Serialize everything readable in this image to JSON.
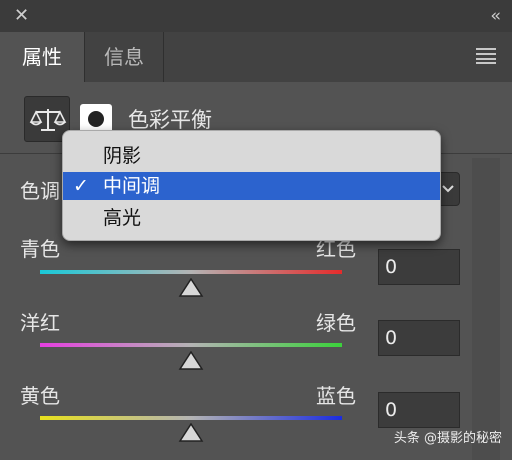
{
  "window": {
    "close_glyph": "✕",
    "collapse_glyph": "‹‹"
  },
  "tabs": [
    {
      "label": "属性",
      "active": true
    },
    {
      "label": "信息",
      "active": false
    }
  ],
  "header": {
    "title": "色彩平衡",
    "icon": "balance-scale-icon",
    "mask_icon": "layer-mask-icon"
  },
  "tone": {
    "label": "色调",
    "selected": "中间调"
  },
  "dropdown": {
    "items": [
      {
        "label": "阴影",
        "selected": false
      },
      {
        "label": "中间调",
        "selected": true
      },
      {
        "label": "高光",
        "selected": false
      }
    ],
    "check_glyph": "✓"
  },
  "sliders": [
    {
      "left_label": "青色",
      "right_label": "红色",
      "value": "0",
      "position": 0.5,
      "colors": [
        "#19c9d8",
        "#b4b4b4",
        "#e52b2b"
      ]
    },
    {
      "left_label": "洋红",
      "right_label": "绿色",
      "value": "0",
      "position": 0.5,
      "colors": [
        "#e63fe0",
        "#b4b4b4",
        "#3bd13b"
      ]
    },
    {
      "left_label": "黄色",
      "right_label": "蓝色",
      "value": "0",
      "position": 0.5,
      "colors": [
        "#e8e11d",
        "#b4b4b4",
        "#1b2ce0"
      ]
    }
  ],
  "watermark": "头条 @摄影的秘密",
  "colors": {
    "panel_bg": "#535353",
    "selection_blue": "#2c63ce",
    "dropdown_bg": "#d9d9d9"
  }
}
